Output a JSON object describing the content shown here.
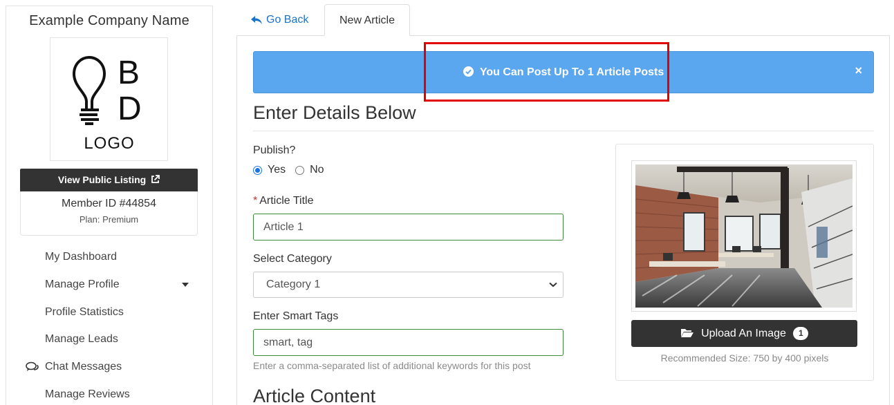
{
  "sidebar": {
    "company_name": "Example Company Name",
    "logo_text": {
      "top_letter": "B",
      "bottom_letter": "D",
      "caption": "LOGO"
    },
    "view_listing_label": "View Public Listing",
    "member_id": "Member ID #44854",
    "plan": "Plan: Premium",
    "nav": [
      {
        "label": "My Dashboard",
        "icon": null
      },
      {
        "label": "Manage Profile",
        "icon": "caret-down-icon"
      },
      {
        "label": "Profile Statistics",
        "icon": null
      },
      {
        "label": "Manage Leads",
        "icon": null
      },
      {
        "label": "Chat Messages",
        "icon": "chat-icon"
      },
      {
        "label": "Manage Reviews",
        "icon": null
      }
    ]
  },
  "tabs": {
    "back_label": "Go Back",
    "active_label": "New Article"
  },
  "alert": {
    "message": "You Can Post Up To 1 Article Posts",
    "close": "×",
    "color": "#5aa6ef"
  },
  "form": {
    "section_title": "Enter Details Below",
    "publish_label": "Publish?",
    "publish_options": [
      "Yes",
      "No"
    ],
    "publish_selected": "Yes",
    "title_label": "Article Title",
    "title_required_mark": "*",
    "title_value": "Article 1",
    "category_label": "Select Category",
    "category_value": "Category 1",
    "tags_label": "Enter Smart Tags",
    "tags_value": "smart, tag",
    "tags_help": "Enter a comma-separated list of additional keywords for this post",
    "content_title": "Article Content"
  },
  "image": {
    "upload_label": "Upload An Image",
    "upload_count": "1",
    "recommended": "Recommended Size: 750 by 400 pixels"
  },
  "colors": {
    "accent_link": "#1a73c8",
    "dark_button": "#333333",
    "highlight": "#e00000",
    "input_border": "#3c8a3c"
  }
}
